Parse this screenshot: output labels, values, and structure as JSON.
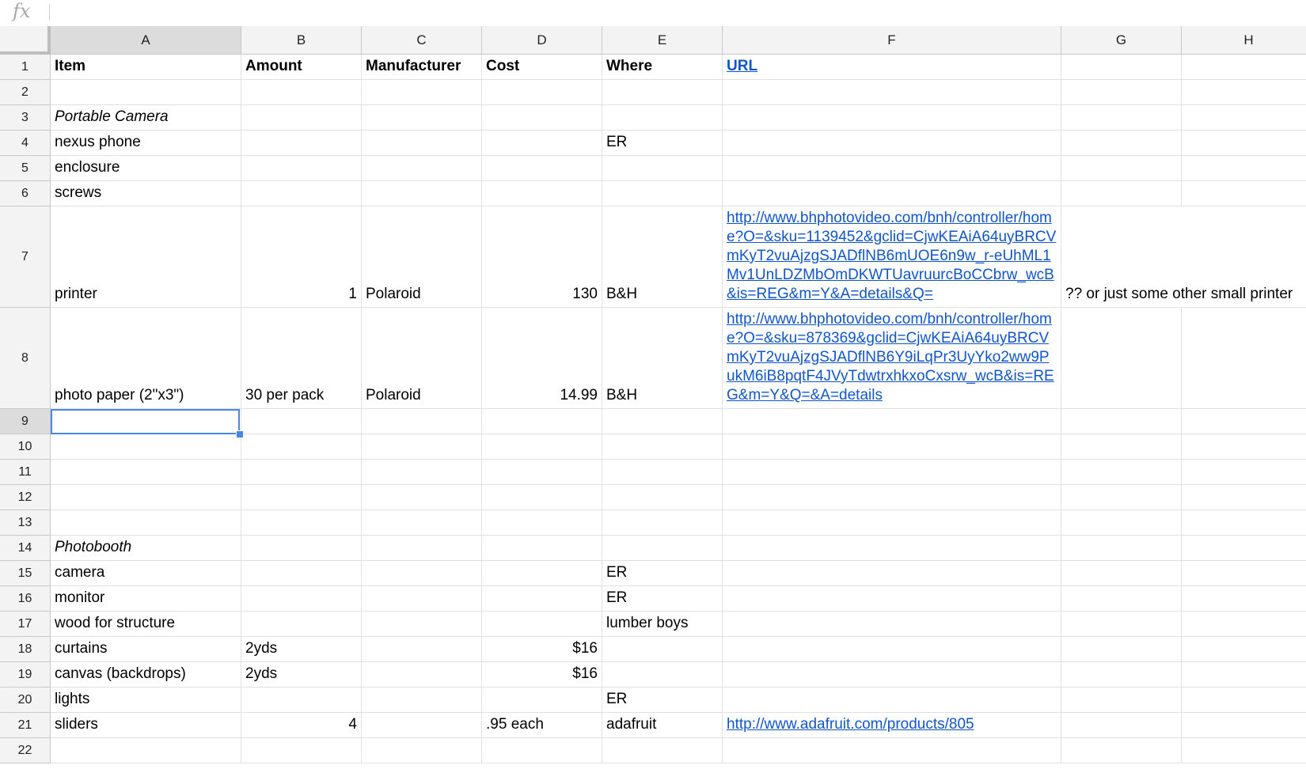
{
  "formula_bar": {
    "icon": "fx",
    "value": ""
  },
  "columns": [
    "A",
    "B",
    "C",
    "D",
    "E",
    "F",
    "G",
    "H"
  ],
  "selected": {
    "row": 9,
    "col": "A"
  },
  "rows": [
    {
      "n": "1",
      "cells": {
        "A": "Item",
        "B": "Amount",
        "C": "Manufacturer",
        "D": "Cost",
        "E": "Where",
        "F": "URL"
      }
    },
    {
      "n": "2",
      "cells": {}
    },
    {
      "n": "3",
      "cells": {
        "A": "Portable Camera"
      }
    },
    {
      "n": "4",
      "cells": {
        "A": "nexus phone",
        "E": "ER"
      }
    },
    {
      "n": "5",
      "cells": {
        "A": "enclosure"
      }
    },
    {
      "n": "6",
      "cells": {
        "A": "screws"
      }
    },
    {
      "n": "7",
      "cells": {
        "A": "printer",
        "B": "1",
        "C": "Polaroid",
        "D": "130",
        "E": "B&H",
        "F": "http://www.bhphotovideo.com/bnh/controller/home?O=&sku=1139452&gclid=CjwKEAiA64uyBRCVmKyT2vuAjzgSJADflNB6mUOE6n9w_r-eUhML1Mv1UnLDZMbOmDKWTUavruurcBoCCbrw_wcB&is=REG&m=Y&A=details&Q=",
        "G": "?? or just some other small printer"
      }
    },
    {
      "n": "8",
      "cells": {
        "A": "photo paper (2\"x3\")",
        "B": "30 per pack",
        "C": "Polaroid",
        "D": "14.99",
        "E": "B&H",
        "F": "http://www.bhphotovideo.com/bnh/controller/home?O=&sku=878369&gclid=CjwKEAiA64uyBRCVmKyT2vuAjzgSJADflNB6Y9iLqPr3UyYko2ww9PukM6iB8pqtF4JVyTdwtrxhkxoCxsrw_wcB&is=REG&m=Y&Q=&A=details"
      }
    },
    {
      "n": "9",
      "cells": {}
    },
    {
      "n": "10",
      "cells": {}
    },
    {
      "n": "11",
      "cells": {}
    },
    {
      "n": "12",
      "cells": {}
    },
    {
      "n": "13",
      "cells": {}
    },
    {
      "n": "14",
      "cells": {
        "A": "Photobooth"
      }
    },
    {
      "n": "15",
      "cells": {
        "A": "camera",
        "E": "ER"
      }
    },
    {
      "n": "16",
      "cells": {
        "A": "monitor",
        "E": "ER"
      }
    },
    {
      "n": "17",
      "cells": {
        "A": "wood for structure",
        "E": "lumber boys"
      }
    },
    {
      "n": "18",
      "cells": {
        "A": "curtains",
        "B": "2yds",
        "D": "$16"
      }
    },
    {
      "n": "19",
      "cells": {
        "A": "canvas (backdrops)",
        "B": "2yds",
        "D": "$16"
      }
    },
    {
      "n": "20",
      "cells": {
        "A": "lights",
        "E": "ER"
      }
    },
    {
      "n": "21",
      "cells": {
        "A": "sliders",
        "B": "4",
        "D": ".95 each",
        "E": "adafruit",
        "F": "http://www.adafruit.com/products/805"
      }
    },
    {
      "n": "22",
      "cells": {}
    }
  ]
}
